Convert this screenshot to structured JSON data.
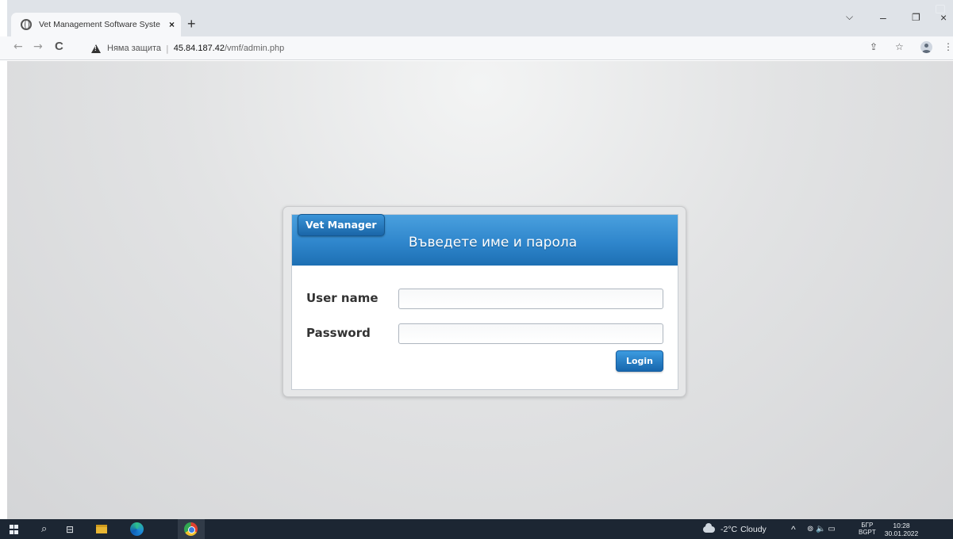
{
  "browser": {
    "tab_title": "Vet Management Software Syste",
    "tab_close": "×",
    "new_tab": "+",
    "window_controls": {
      "tab_search": "⌵",
      "minimize": "–",
      "restore": "❐",
      "close": "×"
    },
    "nav": {
      "back": "←",
      "forward": "→",
      "reload": "C"
    },
    "address": {
      "security_text": "Няма защита",
      "separator": "|",
      "host": "45.84.187.42",
      "path": "/vmf/admin.php"
    },
    "toolbar_icons": {
      "share": "⇪",
      "bookmark": "☆",
      "menu": "⋮"
    }
  },
  "login": {
    "brand": "Vet Manager",
    "title": "Въведете име и парола",
    "username_label": "User name",
    "username_value": "",
    "password_label": "Password",
    "password_value": "",
    "submit_label": "Login"
  },
  "taskbar": {
    "search_icon": "⌕",
    "taskview_icon": "⊟",
    "weather_temp": "-2°C",
    "weather_text": "Cloudy",
    "tray_chevron": "^",
    "tray_icons": "⊚ 🔈 ▭",
    "lang_top": "БГР",
    "lang_bottom": "BGPT",
    "time": "10:28",
    "date": "30.01.2022"
  },
  "colors": {
    "header_blue": "#2f86cc",
    "button_blue": "#1d6fb3",
    "background_gray": "#dcdddf",
    "taskbar": "#1c2633"
  }
}
